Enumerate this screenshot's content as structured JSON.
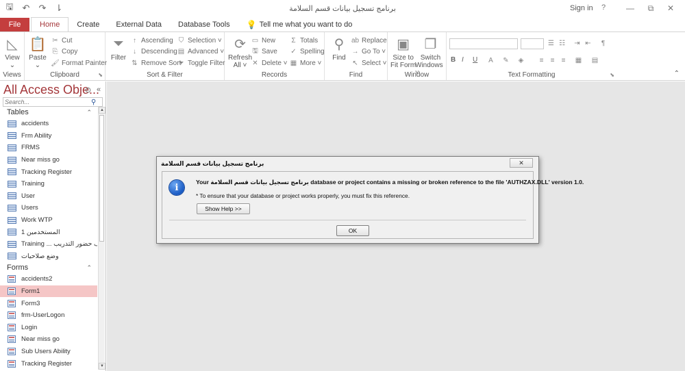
{
  "window": {
    "title": "برنامج تسجيل بيانات قسم السلامة",
    "sign_in": "Sign in",
    "help": "?",
    "minimize": "—",
    "restore": "⧉",
    "close": "✕"
  },
  "qat": {
    "save": "🖫",
    "undo": "↶",
    "redo": "↷",
    "customize": "⇂"
  },
  "tabs": [
    {
      "label": "File"
    },
    {
      "label": "Home"
    },
    {
      "label": "Create"
    },
    {
      "label": "External Data"
    },
    {
      "label": "Database Tools"
    },
    {
      "label": "Tell me what you want to do"
    }
  ],
  "ribbon": {
    "views": {
      "label": "Views",
      "view": "View",
      "view_arrow": "⌄"
    },
    "clipboard": {
      "label": "Clipboard",
      "paste": "Paste",
      "paste_arrow": "⌄",
      "cut": "Cut",
      "copy": "Copy",
      "format_painter": "Format Painter"
    },
    "sort_filter": {
      "label": "Sort & Filter",
      "filter": "Filter",
      "ascending": "Ascending",
      "descending": "Descending",
      "remove_sort": "Remove Sort",
      "selection": "Selection ˅",
      "advanced": "Advanced ˅",
      "toggle_filter": "Toggle Filter"
    },
    "records": {
      "label": "Records",
      "refresh": "Refresh",
      "refresh_all": "All ˅",
      "new": "New",
      "save": "Save",
      "delete": "Delete ˅",
      "totals": "Totals",
      "spelling": "Spelling",
      "more": "More ˅"
    },
    "find": {
      "label": "Find",
      "find": "Find",
      "replace": "Replace",
      "goto": "Go To ˅",
      "select": "Select ˅"
    },
    "window": {
      "label": "Window",
      "size_to_fit": "Size to",
      "size_to_fit2": "Fit Form",
      "switch": "Switch",
      "switch2": "Windows ˅"
    },
    "text_formatting": {
      "label": "Text Formatting",
      "bold": "B",
      "italic": "I",
      "underline": "U"
    }
  },
  "nav": {
    "title": "All Access Obje...",
    "search_placeholder": "Search...",
    "sections": [
      {
        "name": "Tables",
        "items": [
          "accidents",
          "Frm Ability",
          "FRMS",
          "Near miss go",
          "Tracking Register",
          "Training",
          "User",
          "Users",
          "Work WTP",
          "المستخدمين 1",
          "Training ... كشف حضور التدريب",
          "وضع صلاحيات"
        ]
      },
      {
        "name": "Forms",
        "items": [
          "accidents2",
          "Form1",
          "Form3",
          "frm-UserLogon",
          "Login",
          "Near miss go",
          "Sub Users Ability",
          "Tracking Register"
        ]
      }
    ],
    "selected": "Form1"
  },
  "dialog": {
    "title": "برنامج تسجيل بيانات قسم السلامة",
    "close": "✕",
    "message": "Your برنامج تسجيل بيانات قسم السلامة database or project contains a missing or broken reference to the file 'AUTHZAX.DLL' version 1.0.",
    "submessage": "* To ensure that your database or project works properly, you must fix this reference.",
    "help_button": "Show Help >>",
    "ok_button": "OK"
  }
}
